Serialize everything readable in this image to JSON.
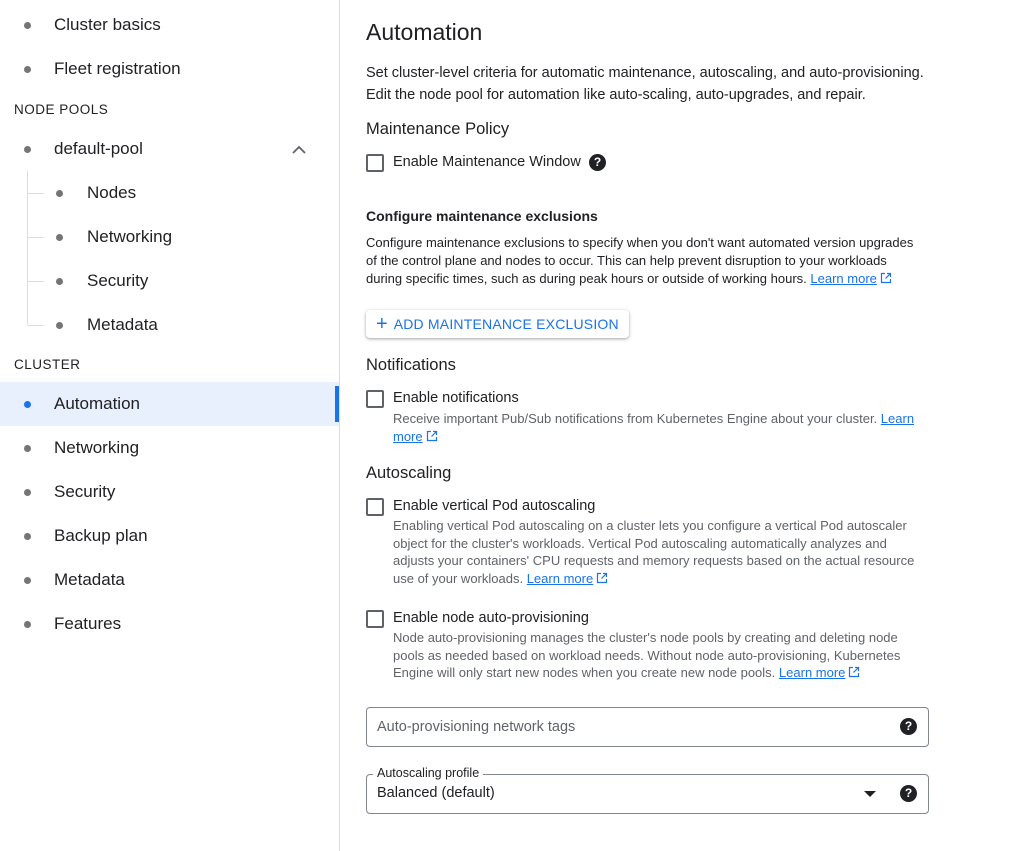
{
  "sidebar": {
    "top_items": [
      {
        "label": "Cluster basics"
      },
      {
        "label": "Fleet registration"
      }
    ],
    "node_pools_heading": "NODE POOLS",
    "pool": {
      "label": "default-pool"
    },
    "pool_items": [
      {
        "label": "Nodes"
      },
      {
        "label": "Networking"
      },
      {
        "label": "Security"
      },
      {
        "label": "Metadata"
      }
    ],
    "cluster_heading": "CLUSTER",
    "cluster_items": [
      {
        "label": "Automation"
      },
      {
        "label": "Networking"
      },
      {
        "label": "Security"
      },
      {
        "label": "Backup plan"
      },
      {
        "label": "Metadata"
      },
      {
        "label": "Features"
      }
    ]
  },
  "main": {
    "title": "Automation",
    "intro_line1": "Set cluster-level criteria for automatic maintenance, autoscaling, and auto-provisioning.",
    "intro_line2": "Edit the node pool for automation like auto-scaling, auto-upgrades, and repair.",
    "maintenance": {
      "heading": "Maintenance Policy",
      "window_label": "Enable Maintenance Window",
      "exclusions_heading": "Configure maintenance exclusions",
      "exclusions_line1": "Configure maintenance exclusions to specify when you don't want automated version upgrades",
      "exclusions_line2": "of the control plane and nodes to occur. This can help prevent disruption to your workloads",
      "exclusions_line3": "during specific times, such as during peak hours or outside of working hours.",
      "learn_more": "Learn more",
      "add_button": "ADD MAINTENANCE EXCLUSION"
    },
    "notifications": {
      "heading": "Notifications",
      "enable_label": "Enable notifications",
      "desc_line1": "Receive important Pub/Sub notifications from Kubernetes Engine about your cluster.",
      "learn_a": "Learn",
      "learn_b": "more"
    },
    "autoscaling": {
      "heading": "Autoscaling",
      "vpa_label": "Enable vertical Pod autoscaling",
      "vpa_line1": "Enabling vertical Pod autoscaling on a cluster lets you configure a vertical Pod autoscaler",
      "vpa_line2": "object for the cluster's workloads. Vertical Pod autoscaling automatically analyzes and",
      "vpa_line3": "adjusts your containers' CPU requests and memory requests based on the actual resource",
      "vpa_line4": "use of your workloads.",
      "nap_label": "Enable node auto-provisioning",
      "nap_line1": "Node auto-provisioning manages the cluster's node pools by creating and deleting node",
      "nap_line2": "pools as needed based on workload needs. Without node auto-provisioning, Kubernetes",
      "nap_line3": "Engine will only start new nodes when you create new node pools.",
      "learn_more": "Learn more",
      "tags_placeholder": "Auto-provisioning network tags",
      "profile_label": "Autoscaling profile",
      "profile_value": "Balanced (default)"
    },
    "help_glyph": "?"
  },
  "colors": {
    "accent": "#1a73e8",
    "active_bg": "#e8f0fe"
  }
}
